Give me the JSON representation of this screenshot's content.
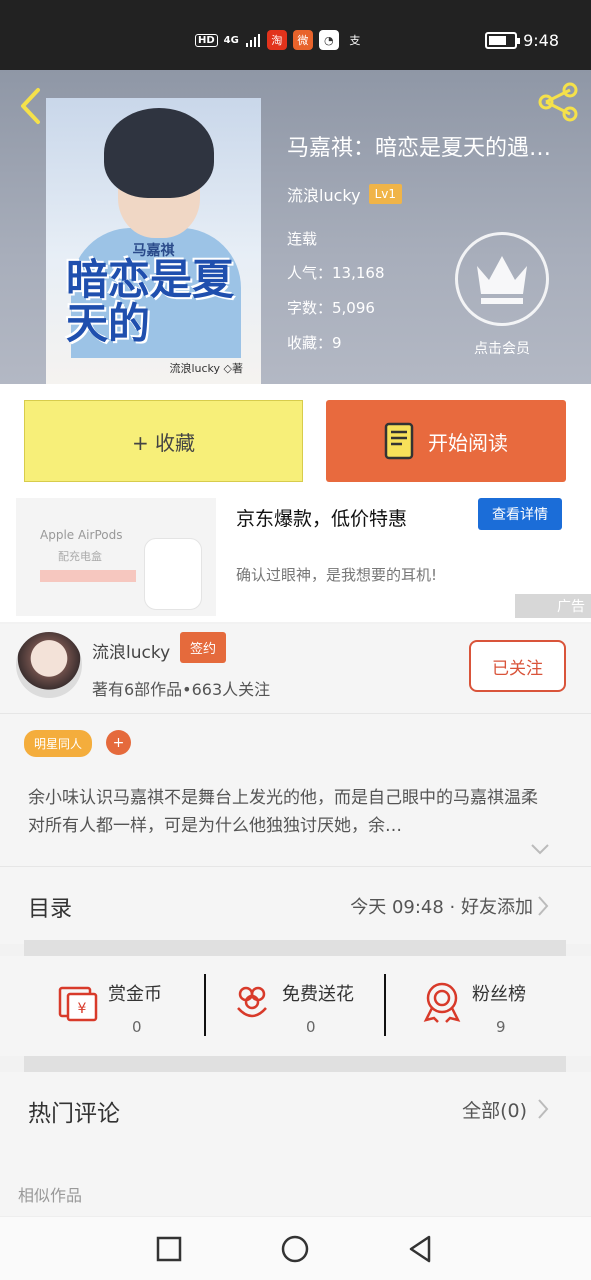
{
  "status_bar": {
    "hd": "HD",
    "signal": "4G",
    "time": "9:48",
    "battery_level": 0.7
  },
  "header": {
    "book_title": "马嘉祺：暗恋是夏天的遇…",
    "author": "流浪lucky",
    "level": "Lv1",
    "status": "连载",
    "popularity": "人气：13,168",
    "word_count": "字数：5,096",
    "favorites": "收藏：9",
    "vip_label": "点击会员",
    "cover": {
      "subtitle": "马嘉祺",
      "title": "暗恋是夏天的",
      "author": "流浪lucky ◇著"
    }
  },
  "actions": {
    "collect": "+ 收藏",
    "read": "开始阅读"
  },
  "ad": {
    "image_title": "Apple AirPods",
    "image_subtitle": "配充电盒",
    "title": "京东爆款，低价特惠",
    "button": "查看详情",
    "desc": "确认过眼神，是我想要的耳机!",
    "badge": "广告"
  },
  "author_section": {
    "name": "流浪lucky",
    "sign_badge": "签约",
    "stats": "著有6部作品•663人关注",
    "follow": "已关注"
  },
  "description": {
    "tag": "明星同人",
    "add_tag": "+",
    "text": "余小味认识马嘉祺不是舞台上发光的他，而是自己眼中的马嘉祺温柔对所有人都一样，可是为什么他独独讨厌她，余…"
  },
  "toc": {
    "label": "目录",
    "update": "今天 09:48 · 好友添加"
  },
  "rewards": [
    {
      "label": "赏金币",
      "value": "0",
      "icon": "coin-envelope-icon"
    },
    {
      "label": "免费送花",
      "value": "0",
      "icon": "flower-icon"
    },
    {
      "label": "粉丝榜",
      "value": "9",
      "icon": "medal-icon"
    }
  ],
  "comments": {
    "label": "热门评论",
    "all": "全部(0)"
  },
  "similar": {
    "label": "相似作品"
  },
  "colors": {
    "accent": "#e86a3e",
    "collect_bg": "#f7ef79",
    "ad_button": "#1b6dd8",
    "level_badge": "#f0b448",
    "tag": "#f4ad3c",
    "reward_red": "#d83a2a"
  }
}
